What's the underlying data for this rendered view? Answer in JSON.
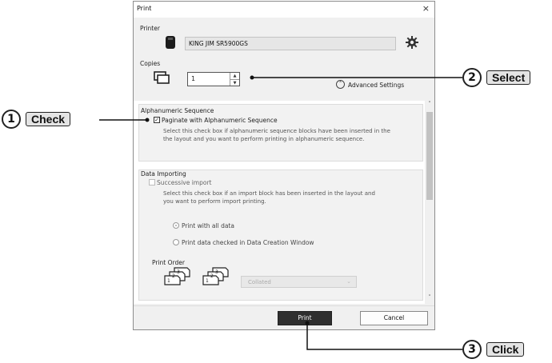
{
  "dialog": {
    "title": "Print",
    "close_glyph": "×",
    "printer_label": "Printer",
    "printer_name": "KING JIM SR5900GS",
    "copies_label": "Copies",
    "copies_value": "1",
    "advanced_settings": "Advanced Settings",
    "alpha": {
      "heading": "Alphanumeric Sequence",
      "checkbox_label": "Paginate with Alphanumeric Sequence",
      "checked": true,
      "desc_line1": "Select this check box if alphanumeric sequence blocks have been inserted in the",
      "desc_line2": "the layout and you want to perform printing in alphanumeric sequence."
    },
    "import": {
      "heading": "Data Importing",
      "checkbox_label": "Successive import",
      "checked": false,
      "desc_line1": "Select this check box if an import block has been inserted in the layout and",
      "desc_line2": "you want to perform import printing.",
      "radio_all": "Print with all data",
      "radio_checked": "Print data checked in Data Creation Window"
    },
    "print_order_label": "Print Order",
    "print_order_value": "Collated",
    "buttons": {
      "print": "Print",
      "cancel": "Cancel"
    }
  },
  "callouts": [
    {
      "number": "1",
      "text": "Check"
    },
    {
      "number": "2",
      "text": "Select"
    },
    {
      "number": "3",
      "text": "Click"
    }
  ]
}
